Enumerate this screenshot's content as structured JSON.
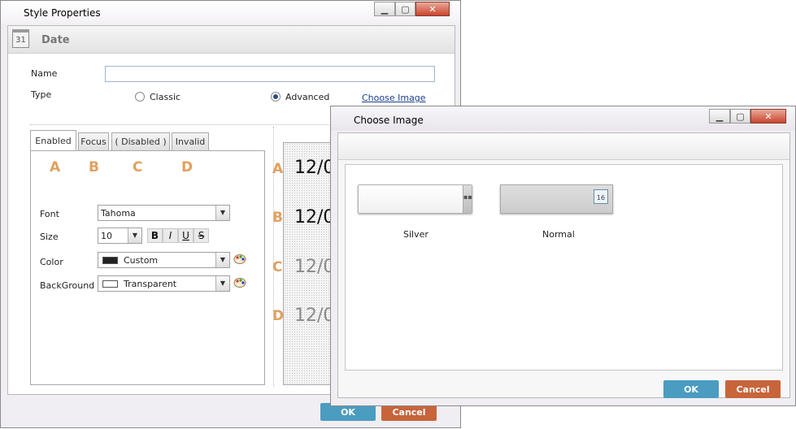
{
  "main_window": {
    "title": "Style Properties",
    "header_title": "Date",
    "calendar_day": "31",
    "name_label": "Name",
    "name_value": "",
    "type_label": "Type",
    "type_options": [
      "Classic",
      "Advanced"
    ],
    "type_selected": "Advanced",
    "choose_image_link": "Choose Image",
    "tabs": [
      "Enabled",
      "Focus",
      "( Disabled )",
      "Invalid"
    ],
    "active_tab": "Enabled",
    "state_letters": [
      "A",
      "B",
      "C",
      "D"
    ],
    "font_label": "Font",
    "font_value": "Tahoma",
    "size_label": "Size",
    "size_value": "10",
    "format_buttons": [
      "B",
      "I",
      "U",
      "S"
    ],
    "color_label": "Color",
    "color_value": "Custom",
    "color_swatch": "#222222",
    "background_label": "BackGround",
    "background_value": "Transparent",
    "preview": [
      {
        "letter": "A",
        "text": "12/0"
      },
      {
        "letter": "B",
        "text": "12/0"
      },
      {
        "letter": "C",
        "text": "12/0"
      },
      {
        "letter": "D",
        "text": "12/0"
      }
    ],
    "ok_label": "OK",
    "cancel_label": "Cancel"
  },
  "choose_image_dialog": {
    "title": "Choose Image",
    "options": [
      {
        "label": "Silver",
        "icon": "ellipsis-icon"
      },
      {
        "label": "Normal",
        "icon": "calendar-icon",
        "calendar_day": "16"
      }
    ],
    "ok_label": "OK",
    "cancel_label": "Cancel"
  },
  "colors": {
    "ok_button": "#4a9cc0",
    "cancel_button": "#c8643a",
    "accent_letters": "#e0a060",
    "link": "#1a3e8f"
  }
}
